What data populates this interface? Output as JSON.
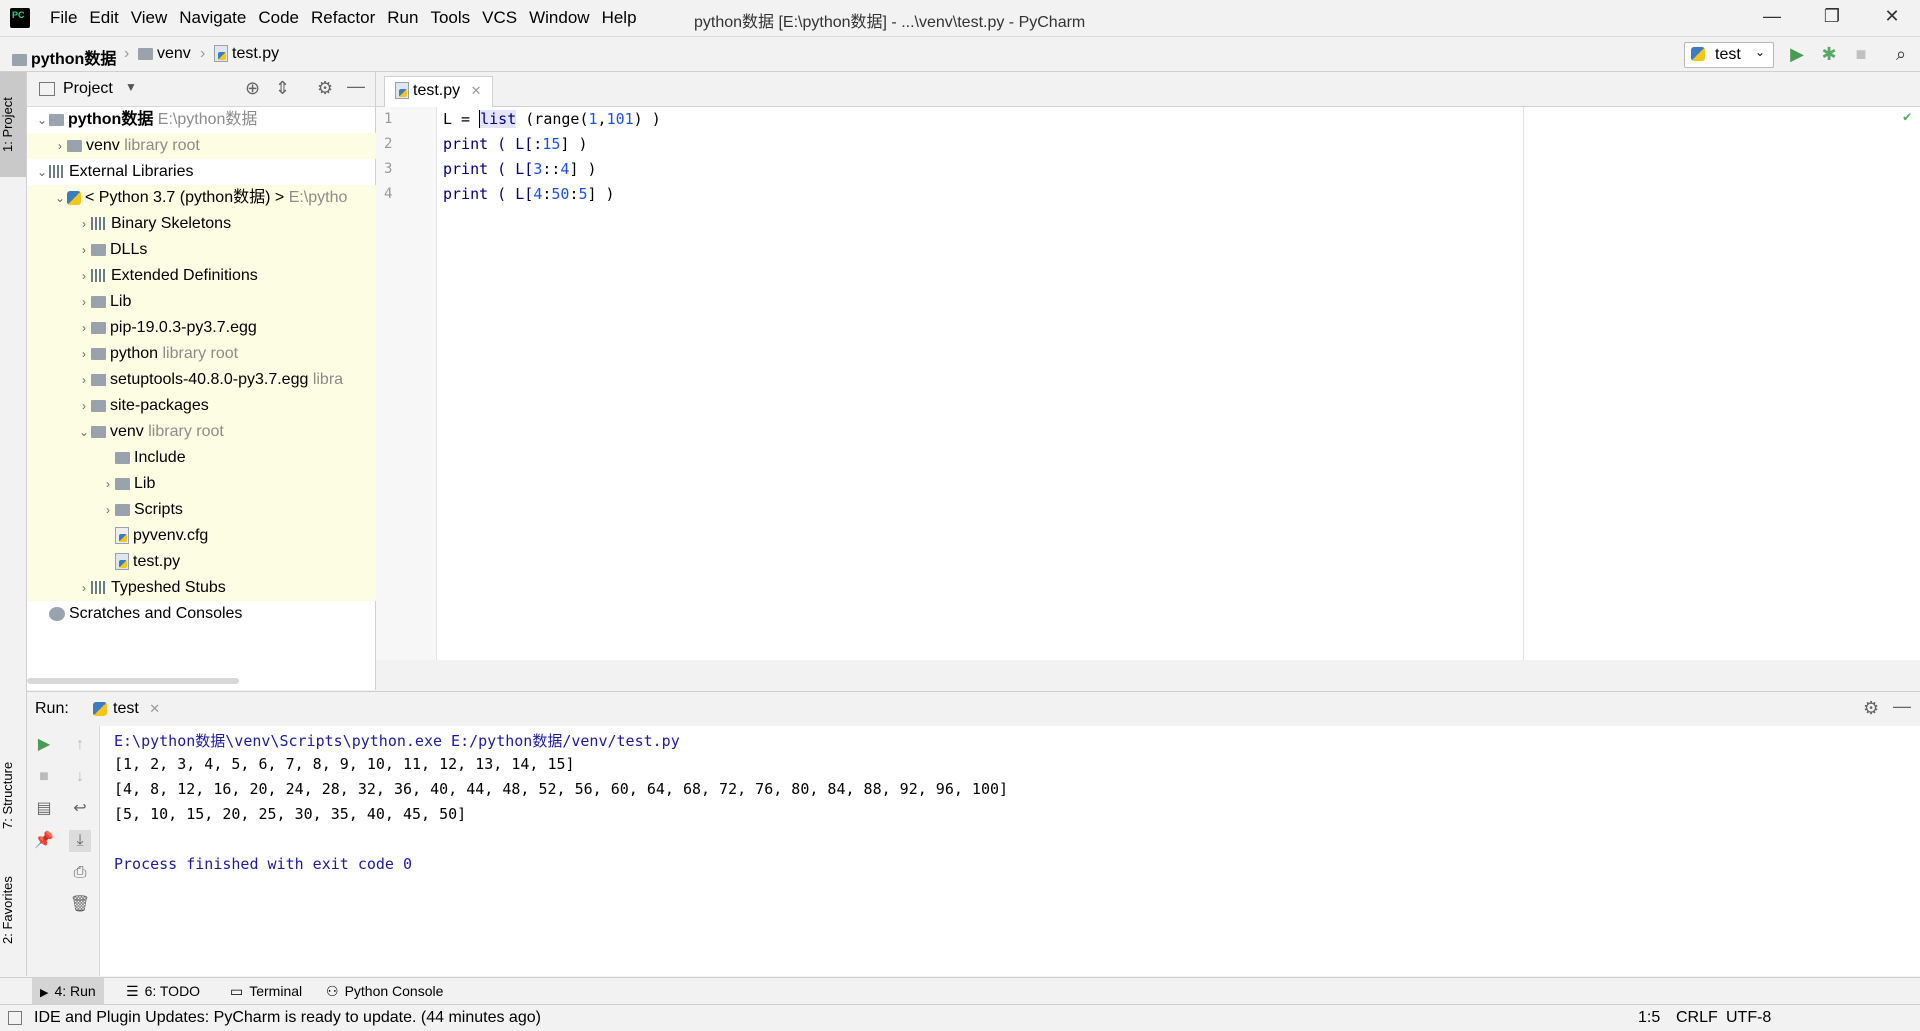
{
  "menu": [
    "File",
    "Edit",
    "View",
    "Navigate",
    "Code",
    "Refactor",
    "Run",
    "Tools",
    "VCS",
    "Window",
    "Help"
  ],
  "window_title": "python数据 [E:\\python数据] - ...\\venv\\test.py - PyCharm",
  "breadcrumb": {
    "project": "python数据",
    "folder": "venv",
    "file": "test.py"
  },
  "run_config": "test",
  "left_tabs": {
    "project": "1: Project",
    "structure": "7: Structure",
    "favorites": "2: Favorites"
  },
  "project_panel": {
    "title": "Project",
    "tree": [
      {
        "label": "python数据",
        "hint": "E:\\python数据",
        "bold": true
      },
      {
        "label": "venv",
        "hint": "library root"
      },
      {
        "label": "External Libraries",
        "hint": ""
      },
      {
        "label": "< Python 3.7 (python数据) >",
        "hint": "E:\\pytho"
      },
      {
        "label": "Binary Skeletons",
        "hint": ""
      },
      {
        "label": "DLLs",
        "hint": ""
      },
      {
        "label": "Extended Definitions",
        "hint": ""
      },
      {
        "label": "Lib",
        "hint": ""
      },
      {
        "label": "pip-19.0.3-py3.7.egg",
        "hint": ""
      },
      {
        "label": "python",
        "hint": "library root"
      },
      {
        "label": "setuptools-40.8.0-py3.7.egg",
        "hint": "libra"
      },
      {
        "label": "site-packages",
        "hint": ""
      },
      {
        "label": "venv",
        "hint": "library root"
      },
      {
        "label": "Include",
        "hint": ""
      },
      {
        "label": "Lib",
        "hint": ""
      },
      {
        "label": "Scripts",
        "hint": ""
      },
      {
        "label": "pyvenv.cfg",
        "hint": ""
      },
      {
        "label": "test.py",
        "hint": ""
      },
      {
        "label": "Typeshed Stubs",
        "hint": ""
      },
      {
        "label": "Scratches and Consoles",
        "hint": ""
      }
    ]
  },
  "editor": {
    "tab": "test.py",
    "line_numbers": [
      "1",
      "2",
      "3",
      "4"
    ],
    "lines": [
      {
        "a": "L = ",
        "b": "list",
        "c": " (range(",
        "d": "1",
        "e": ",",
        "f": "101",
        "g": ") )"
      },
      {
        "a": "print ( L[:",
        "d": "15",
        "g": "] )"
      },
      {
        "a": "print ( L[",
        "d": "3",
        "e": "::",
        "f": "4",
        "g": "] )"
      },
      {
        "a": "print ( L[",
        "d": "4",
        "e": ":",
        "f": "50",
        "e2": ":",
        "f2": "5",
        "g": "] )"
      }
    ]
  },
  "run_panel": {
    "label": "Run:",
    "tab": "test",
    "output": [
      "E:\\python数据\\venv\\Scripts\\python.exe E:/python数据/venv/test.py",
      "[1, 2, 3, 4, 5, 6, 7, 8, 9, 10, 11, 12, 13, 14, 15]",
      "[4, 8, 12, 16, 20, 24, 28, 32, 36, 40, 44, 48, 52, 56, 60, 64, 68, 72, 76, 80, 84, 88, 92, 96, 100]",
      "[5, 10, 15, 20, 25, 30, 35, 40, 45, 50]",
      "",
      "Process finished with exit code 0"
    ]
  },
  "bottom_tabs": [
    "4: Run",
    "6: TODO",
    "Terminal",
    "Python Console"
  ],
  "status": {
    "message": "IDE and Plugin Updates: PyCharm is ready to update. (44 minutes ago)",
    "position": "1:5",
    "line_sep": "CRLF",
    "encoding": "UTF-8"
  },
  "colors": {
    "accent_tab": "#4083c9",
    "run_green": "#499c54",
    "debug_green": "#59a869",
    "highlight_row": "#fdfde3"
  }
}
